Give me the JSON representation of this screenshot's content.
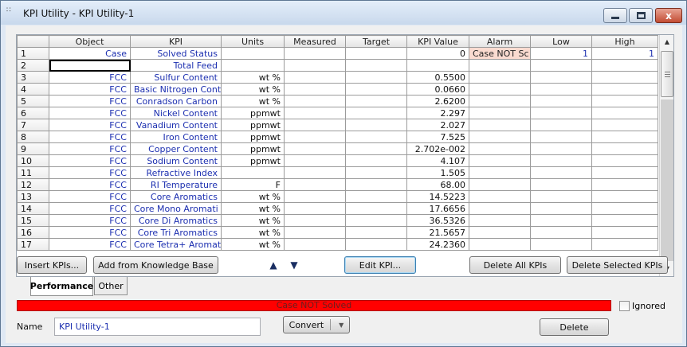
{
  "window": {
    "title": "KPI Utility - KPI Utility-1",
    "min_glyph": "",
    "close_glyph": "x",
    "app_icon": "grid-app-icon"
  },
  "grid": {
    "columns": [
      "",
      "Object",
      "KPI",
      "Units",
      "Measured",
      "Target",
      "KPI Value",
      "Alarm",
      "Low",
      "High"
    ],
    "rows": [
      {
        "n": "1",
        "object": "Case",
        "kpi": "Solved Status",
        "units": "",
        "measured": "",
        "target": "",
        "value": "0",
        "alarm": "Case NOT Sc",
        "low": "1",
        "high": "1"
      },
      {
        "n": "2",
        "object": "",
        "kpi": "Total Feed",
        "units": "",
        "measured": "",
        "target": "",
        "value": "",
        "alarm": "",
        "low": "",
        "high": ""
      },
      {
        "n": "3",
        "object": "FCC",
        "kpi": "Sulfur Content",
        "units": "wt %",
        "measured": "",
        "target": "",
        "value": "0.5500",
        "alarm": "",
        "low": "",
        "high": ""
      },
      {
        "n": "4",
        "object": "FCC",
        "kpi": "Basic Nitrogen Cont",
        "units": "wt %",
        "measured": "",
        "target": "",
        "value": "0.0660",
        "alarm": "",
        "low": "",
        "high": ""
      },
      {
        "n": "5",
        "object": "FCC",
        "kpi": "Conradson Carbon",
        "units": "wt %",
        "measured": "",
        "target": "",
        "value": "2.6200",
        "alarm": "",
        "low": "",
        "high": ""
      },
      {
        "n": "6",
        "object": "FCC",
        "kpi": "Nickel Content",
        "units": "ppmwt",
        "measured": "",
        "target": "",
        "value": "2.297",
        "alarm": "",
        "low": "",
        "high": ""
      },
      {
        "n": "7",
        "object": "FCC",
        "kpi": "Vanadium Content",
        "units": "ppmwt",
        "measured": "",
        "target": "",
        "value": "2.027",
        "alarm": "",
        "low": "",
        "high": ""
      },
      {
        "n": "8",
        "object": "FCC",
        "kpi": "Iron Content",
        "units": "ppmwt",
        "measured": "",
        "target": "",
        "value": "7.525",
        "alarm": "",
        "low": "",
        "high": ""
      },
      {
        "n": "9",
        "object": "FCC",
        "kpi": "Copper Content",
        "units": "ppmwt",
        "measured": "",
        "target": "",
        "value": "2.702e-002",
        "alarm": "",
        "low": "",
        "high": ""
      },
      {
        "n": "10",
        "object": "FCC",
        "kpi": "Sodium Content",
        "units": "ppmwt",
        "measured": "",
        "target": "",
        "value": "4.107",
        "alarm": "",
        "low": "",
        "high": ""
      },
      {
        "n": "11",
        "object": "FCC",
        "kpi": "Refractive Index",
        "units": "",
        "measured": "",
        "target": "",
        "value": "1.505",
        "alarm": "",
        "low": "",
        "high": ""
      },
      {
        "n": "12",
        "object": "FCC",
        "kpi": "RI Temperature",
        "units": "F",
        "measured": "",
        "target": "",
        "value": "68.00",
        "alarm": "",
        "low": "",
        "high": ""
      },
      {
        "n": "13",
        "object": "FCC",
        "kpi": "Core Aromatics",
        "units": "wt %",
        "measured": "",
        "target": "",
        "value": "14.5223",
        "alarm": "",
        "low": "",
        "high": ""
      },
      {
        "n": "14",
        "object": "FCC",
        "kpi": "Core Mono Aromati",
        "units": "wt %",
        "measured": "",
        "target": "",
        "value": "17.6656",
        "alarm": "",
        "low": "",
        "high": ""
      },
      {
        "n": "15",
        "object": "FCC",
        "kpi": "Core Di Aromatics",
        "units": "wt %",
        "measured": "",
        "target": "",
        "value": "36.5326",
        "alarm": "",
        "low": "",
        "high": ""
      },
      {
        "n": "16",
        "object": "FCC",
        "kpi": "Core Tri Aromatics",
        "units": "wt %",
        "measured": "",
        "target": "",
        "value": "21.5657",
        "alarm": "",
        "low": "",
        "high": ""
      },
      {
        "n": "17",
        "object": "FCC",
        "kpi": "Core Tetra+ Aromati",
        "units": "wt %",
        "measured": "",
        "target": "",
        "value": "24.2360",
        "alarm": "",
        "low": "",
        "high": ""
      }
    ]
  },
  "buttons": {
    "insert": "Insert KPIs...",
    "add_kb": "Add from Knowledge Base",
    "edit": "Edit KPI...",
    "delete_all": "Delete All KPIs",
    "delete_selected": "Delete Selected KPIs",
    "convert": "Convert",
    "delete": "Delete"
  },
  "tabs": [
    "Performance",
    "Other"
  ],
  "status": {
    "text": "Case NOT Solved",
    "color": "#ff0000"
  },
  "ignored_label": "Ignored",
  "name_label": "Name",
  "name_value": "KPI Utility-1",
  "colors": {
    "link_text": "#1c2fb0",
    "alarm_bg": "#fadbd0"
  }
}
